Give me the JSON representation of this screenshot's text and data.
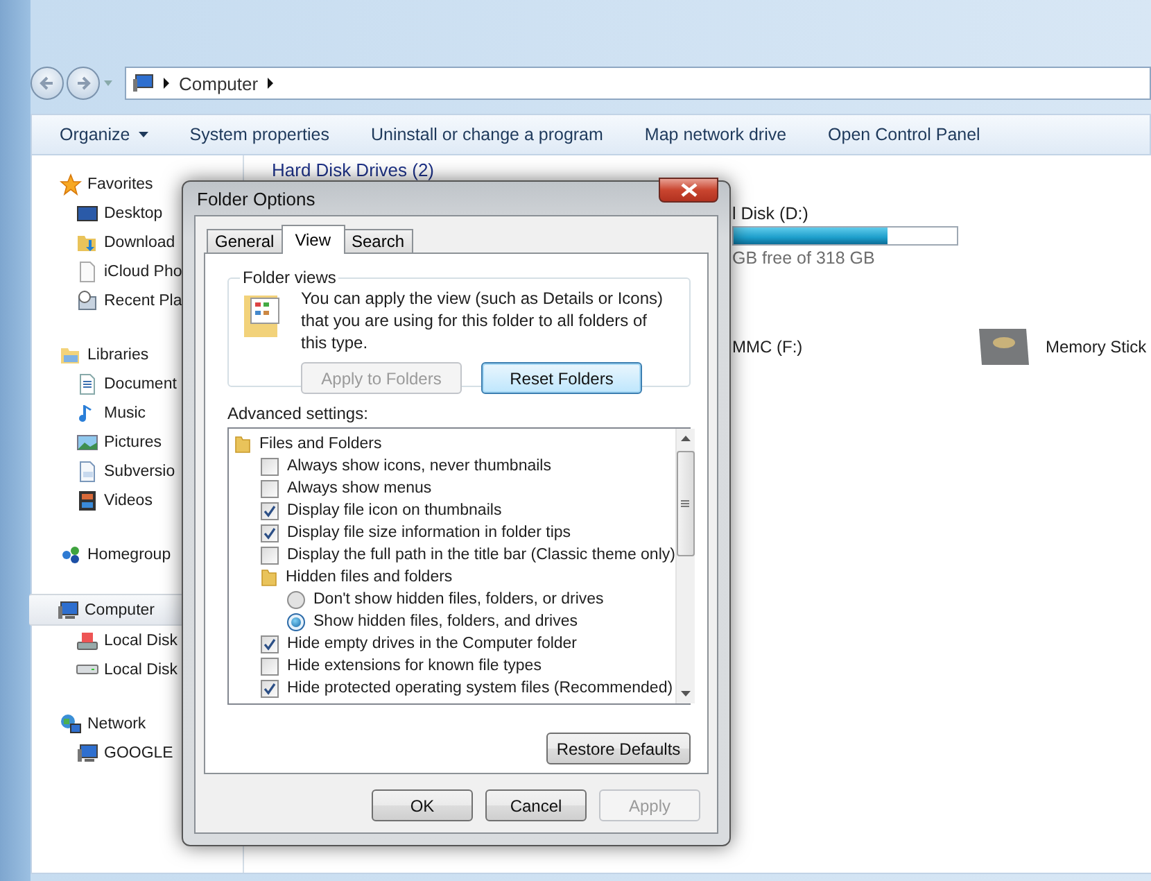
{
  "address": {
    "crumbs": [
      "Computer"
    ]
  },
  "toolbar": [
    {
      "label": "Organize",
      "menu": true
    },
    {
      "label": "System properties",
      "menu": false
    },
    {
      "label": "Uninstall or change a program",
      "menu": false
    },
    {
      "label": "Map network drive",
      "menu": false
    },
    {
      "label": "Open Control Panel",
      "menu": false
    }
  ],
  "sidebar": [
    {
      "label": "Favorites",
      "selected": false,
      "children": [
        {
          "label": "Desktop",
          "selected": false
        },
        {
          "label": "Download",
          "selected": false
        },
        {
          "label": "iCloud Pho",
          "selected": false
        },
        {
          "label": "Recent Pla",
          "selected": false
        }
      ]
    },
    {
      "label": "Libraries",
      "selected": false,
      "children": [
        {
          "label": "Document",
          "selected": false
        },
        {
          "label": "Music",
          "selected": false
        },
        {
          "label": "Pictures",
          "selected": false
        },
        {
          "label": "Subversio",
          "selected": false
        },
        {
          "label": "Videos",
          "selected": false
        }
      ]
    },
    {
      "label": "Homegroup",
      "selected": false
    },
    {
      "label": "Computer",
      "selected": true,
      "children": [
        {
          "label": "Local Disk",
          "selected": false
        },
        {
          "label": "Local Disk",
          "selected": false
        }
      ]
    },
    {
      "label": "Network",
      "selected": false,
      "children": [
        {
          "label": "GOOGLE",
          "selected": false
        }
      ]
    }
  ],
  "content": {
    "group_title": "Hard Disk Drives (2)",
    "drive": {
      "name": "l Disk (D:)",
      "free": "GB free of 318 GB",
      "level": 0.69
    },
    "removables": [
      {
        "name": "MMC (F:)"
      },
      {
        "name": "Memory Stick"
      }
    ]
  },
  "dialog": {
    "title": "Folder Options",
    "tabs": [
      {
        "label": "General",
        "selected": false
      },
      {
        "label": "View",
        "selected": true
      },
      {
        "label": "Search",
        "selected": false
      }
    ],
    "folder_views": {
      "legend": "Folder views",
      "text": "You can apply the view (such as Details or Icons) that you are using for this folder to all folders of this type.",
      "buttons": [
        {
          "label": "Apply to Folders",
          "disabled": true,
          "default": false
        },
        {
          "label": "Reset Folders",
          "disabled": false,
          "default": true
        }
      ]
    },
    "advanced_label": "Advanced settings:",
    "settings": [
      {
        "kind": "folder",
        "label": "Files and Folders",
        "children": [
          {
            "kind": "checkbox",
            "label": "Always show icons, never thumbnails",
            "checked": false
          },
          {
            "kind": "checkbox",
            "label": "Always show menus",
            "checked": false
          },
          {
            "kind": "checkbox",
            "label": "Display file icon on thumbnails",
            "checked": true
          },
          {
            "kind": "checkbox",
            "label": "Display file size information in folder tips",
            "checked": true
          },
          {
            "kind": "checkbox",
            "label": "Display the full path in the title bar (Classic theme only)",
            "checked": false
          },
          {
            "kind": "folder",
            "label": "Hidden files and folders",
            "children": [
              {
                "kind": "radio",
                "label": "Don't show hidden files, folders, or drives",
                "selected": false
              },
              {
                "kind": "radio",
                "label": "Show hidden files, folders, and drives",
                "selected": true
              }
            ]
          },
          {
            "kind": "checkbox",
            "label": "Hide empty drives in the Computer folder",
            "checked": true
          },
          {
            "kind": "checkbox",
            "label": "Hide extensions for known file types",
            "checked": false
          },
          {
            "kind": "checkbox",
            "label": "Hide protected operating system files (Recommended)",
            "checked": true
          }
        ]
      }
    ],
    "restore_button": "Restore Defaults",
    "buttons": [
      {
        "label": "OK",
        "disabled": false
      },
      {
        "label": "Cancel",
        "disabled": false
      },
      {
        "label": "Apply",
        "disabled": true
      }
    ]
  }
}
